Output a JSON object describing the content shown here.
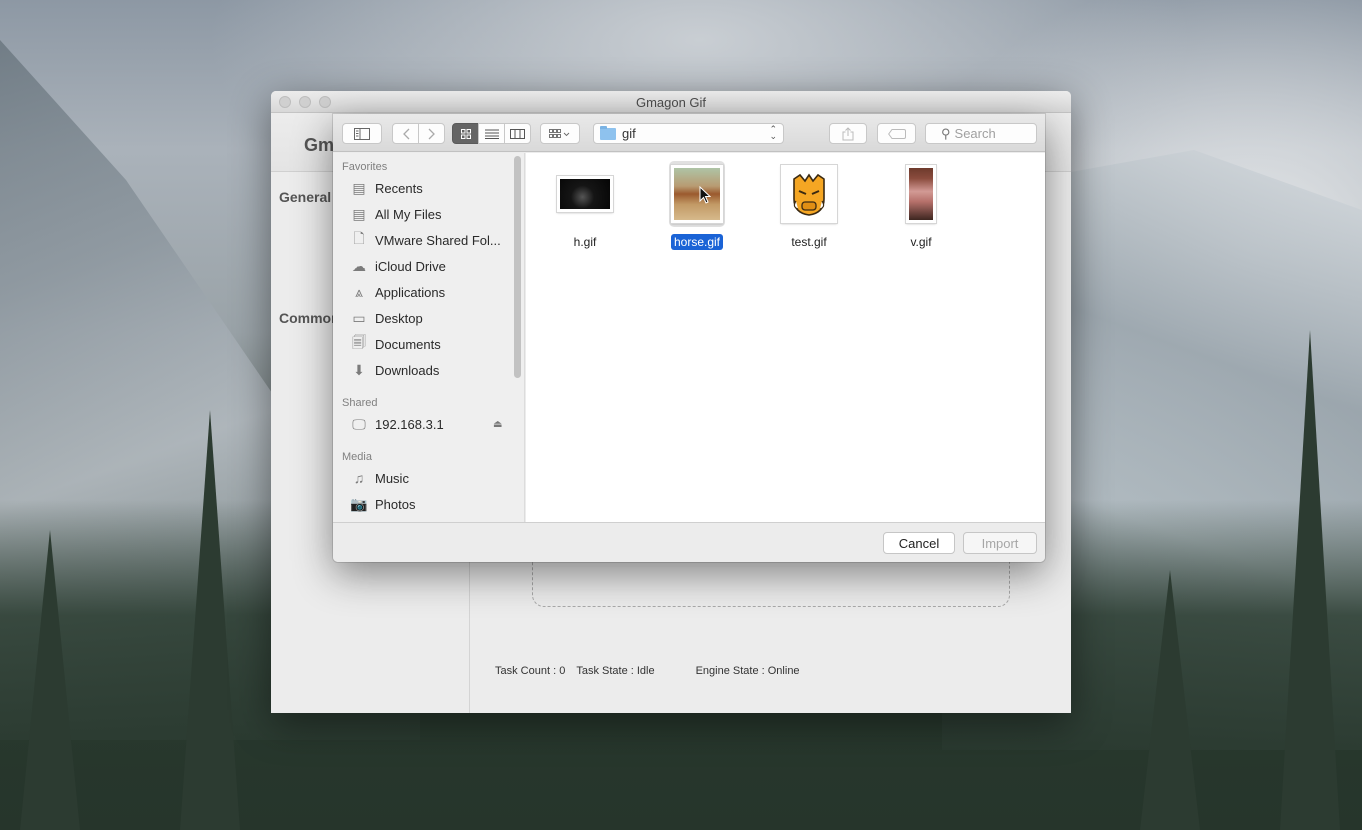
{
  "window": {
    "title": "Gmagon Gif",
    "logo_fragment": "Gm",
    "sections": [
      "General",
      "Commor"
    ],
    "status": {
      "task_count": "Task Count : 0",
      "task_state": "Task State : Idle",
      "engine_state": "Engine State : Online"
    }
  },
  "dialog": {
    "toolbar": {
      "sidebar_toggle_icon": "sidebar-icon",
      "back_icon": "chevron-left-icon",
      "forward_icon": "chevron-right-icon",
      "view_modes": [
        {
          "name": "icon-view",
          "glyph": "⊞",
          "active": true
        },
        {
          "name": "list-view",
          "glyph": "☰",
          "active": false
        },
        {
          "name": "column-view",
          "glyph": "▥",
          "active": false
        }
      ],
      "arrange_glyph": "⁝⁝⁝ ⌄",
      "location": "gif",
      "share_glyph": "⇪",
      "tag_glyph": "⬭",
      "search_placeholder": "Search"
    },
    "sidebar": {
      "favorites_label": "Favorites",
      "favorites": [
        {
          "label": "Recents",
          "icon": "recents-icon",
          "glyph": "▤"
        },
        {
          "label": "All My Files",
          "icon": "all-files-icon",
          "glyph": "▤"
        },
        {
          "label": "VMware Shared Fol...",
          "icon": "document-icon",
          "glyph": "🗋"
        },
        {
          "label": "iCloud Drive",
          "icon": "cloud-icon",
          "glyph": "☁"
        },
        {
          "label": "Applications",
          "icon": "applications-icon",
          "glyph": "⩓"
        },
        {
          "label": "Desktop",
          "icon": "desktop-icon",
          "glyph": "▭"
        },
        {
          "label": "Documents",
          "icon": "documents-icon",
          "glyph": "🗐"
        },
        {
          "label": "Downloads",
          "icon": "downloads-icon",
          "glyph": "⬇"
        }
      ],
      "shared_label": "Shared",
      "shared": [
        {
          "label": "192.168.3.1",
          "icon": "monitor-icon",
          "glyph": "🖵",
          "eject": "⏏"
        }
      ],
      "media_label": "Media",
      "media": [
        {
          "label": "Music",
          "icon": "music-icon",
          "glyph": "♫"
        },
        {
          "label": "Photos",
          "icon": "camera-icon",
          "glyph": "📷"
        }
      ]
    },
    "files": [
      {
        "name": "h.gif",
        "selected": false
      },
      {
        "name": "horse.gif",
        "selected": true
      },
      {
        "name": "test.gif",
        "selected": false
      },
      {
        "name": "v.gif",
        "selected": false
      }
    ],
    "buttons": {
      "cancel": "Cancel",
      "import": "Import"
    },
    "colors": {
      "selection": "#1a63d6",
      "active_view": "#656565"
    }
  }
}
